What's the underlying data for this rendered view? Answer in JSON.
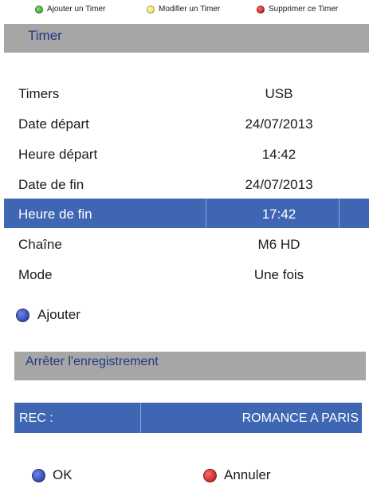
{
  "legend": {
    "add": {
      "label": "Ajouter un Timer",
      "color": "#4caf3a",
      "icon": "green-dot-icon"
    },
    "edit": {
      "label": "Modifier un Timer",
      "color": "#f2e36a",
      "icon": "yellow-dot-icon"
    },
    "delete": {
      "label": "Supprimer ce Timer",
      "color": "#c0141b",
      "icon": "red-dot-icon"
    }
  },
  "header": {
    "title": "Timer"
  },
  "form": {
    "rows": [
      {
        "label": "Timers",
        "value": "USB"
      },
      {
        "label": "Date départ",
        "value": "24/07/2013"
      },
      {
        "label": "Heure départ",
        "value": "14:42"
      },
      {
        "label": "Date de fin",
        "value": "24/07/2013"
      },
      {
        "label": "Heure de fin",
        "value": "17:42",
        "selected": true
      },
      {
        "label": "Chaîne",
        "value": "M6 HD"
      },
      {
        "label": "Mode",
        "value": "Une fois"
      }
    ]
  },
  "actions": {
    "add_label": "Ajouter"
  },
  "section": {
    "title": "Arrêter l'enregistrement"
  },
  "rec": {
    "label": "REC :",
    "value": "ROMANCE A PARIS"
  },
  "footer": {
    "ok_label": "OK",
    "cancel_label": "Annuler"
  },
  "colors": {
    "highlight": "#3f66b3",
    "bar_gray": "#a6a6a6",
    "bar_text": "#203a84"
  }
}
